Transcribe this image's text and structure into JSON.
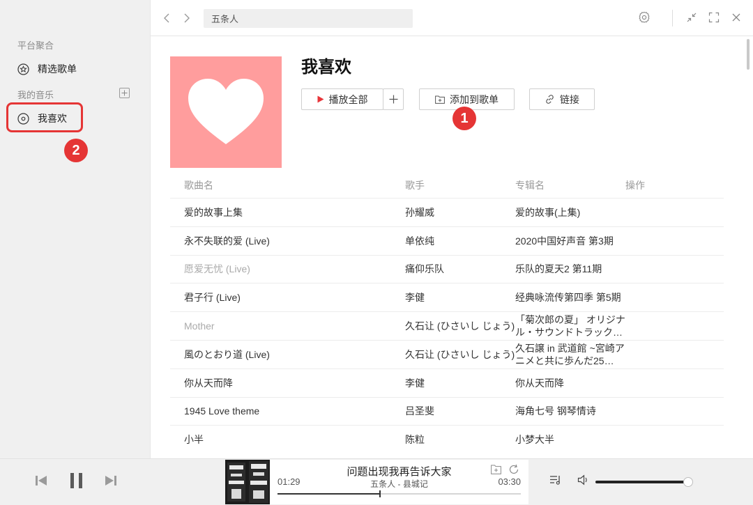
{
  "sidebar": {
    "section_platform": "平台聚合",
    "featured_label": "精选歌单",
    "section_my_music": "我的音乐",
    "liked_label": "我喜欢"
  },
  "annotations": {
    "callout_1": "1",
    "callout_2": "2"
  },
  "topbar": {
    "search_value": "五条人"
  },
  "playlist": {
    "title": "我喜欢",
    "play_all_label": "播放全部",
    "add_to_playlist_label": "添加到歌单",
    "link_label": "链接"
  },
  "table": {
    "headers": [
      "歌曲名",
      "歌手",
      "专辑名",
      "操作"
    ],
    "rows": [
      {
        "song": "爱的故事上集",
        "artist": "孙耀威",
        "album": "爱的故事(上集)",
        "dim": false
      },
      {
        "song": "永不失联的爱 (Live)",
        "artist": "单依纯",
        "album": "2020中国好声音 第3期",
        "dim": false
      },
      {
        "song": "愿爱无忧 (Live)",
        "artist": "痛仰乐队",
        "album": "乐队的夏天2 第11期",
        "dim": true
      },
      {
        "song": "君子行 (Live)",
        "artist": "李健",
        "album": "经典咏流传第四季 第5期",
        "dim": false
      },
      {
        "song": "Mother",
        "artist": "久石让 (ひさいし じょう)",
        "album": "「菊次郎の夏」 オリジナル・サウンドトラック…",
        "dim": true
      },
      {
        "song": "風のとおり道 (Live)",
        "artist": "久石让 (ひさいし じょう)",
        "album": "久石譲 in 武道館 ~宮崎アニメと共に歩んだ25…",
        "dim": false
      },
      {
        "song": "你从天而降",
        "artist": "李健",
        "album": "你从天而降",
        "dim": false
      },
      {
        "song": "1945 Love theme",
        "artist": "吕圣斐",
        "album": "海角七号 钢琴情诗",
        "dim": false
      },
      {
        "song": "小半",
        "artist": "陈粒",
        "album": "小梦大半",
        "dim": false
      }
    ]
  },
  "player": {
    "track_title": "问题出现我再告诉大家",
    "track_artist_album": "五条人 - 县城记",
    "elapsed": "01:29",
    "duration": "03:30",
    "progress": 0.42,
    "volume": 0.95
  },
  "colors": {
    "accent_red": "#e53535",
    "cover_pink": "#ff9d9d",
    "play_icon_red": "#e8353a"
  }
}
